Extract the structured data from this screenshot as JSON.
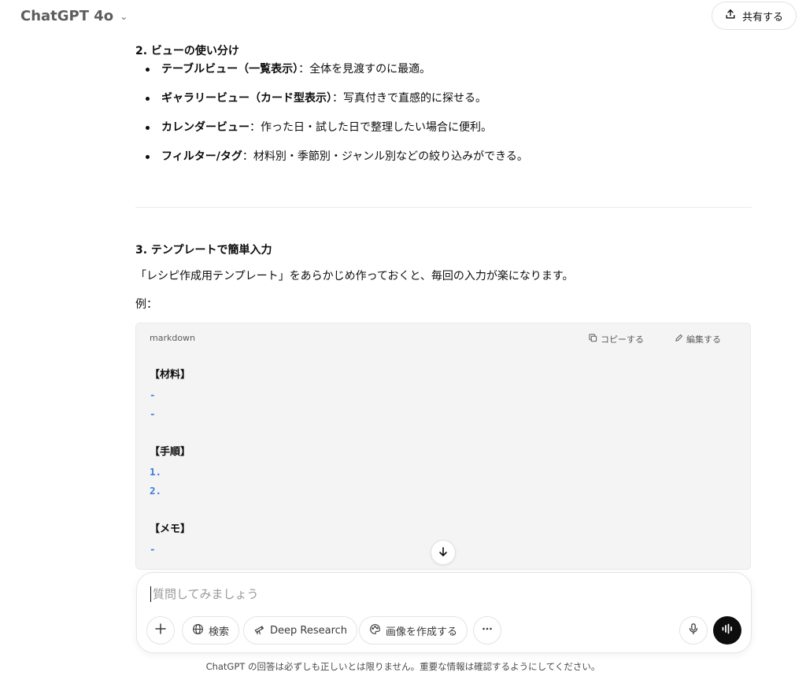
{
  "header": {
    "model": "ChatGPT 4o",
    "share_label": "共有する"
  },
  "section2": {
    "heading": "2. ビューの使い分け",
    "items": [
      {
        "bold": "テーブルビュー（一覧表示）",
        "text": "：全体を見渡すのに最適。"
      },
      {
        "bold": "ギャラリービュー（カード型表示）",
        "text": "：写真付きで直感的に探せる。"
      },
      {
        "bold": "カレンダービュー",
        "text": "：作った日・試した日で整理したい場合に便利。"
      },
      {
        "bold": "フィルター/タグ",
        "text": "：材料別・季節別・ジャンル別などの絞り込みができる。"
      }
    ]
  },
  "section3": {
    "heading": "3. テンプレートで簡単入力",
    "description": "「レシピ作成用テンプレート」をあらかじめ作っておくと、毎回の入力が楽になります。",
    "example_label": "例："
  },
  "code": {
    "language": "markdown",
    "copy_label": "コピーする",
    "edit_label": "編集する",
    "lines": [
      {
        "type": "heading",
        "text": "【材料】"
      },
      {
        "type": "marker",
        "text": "-"
      },
      {
        "type": "marker",
        "text": "-"
      },
      {
        "type": "blank",
        "text": ""
      },
      {
        "type": "heading",
        "text": "【手順】"
      },
      {
        "type": "marker",
        "text": "1."
      },
      {
        "type": "marker",
        "text": "2."
      },
      {
        "type": "blank",
        "text": ""
      },
      {
        "type": "heading",
        "text": "【メモ】"
      },
      {
        "type": "marker",
        "text": "-"
      }
    ]
  },
  "composer": {
    "placeholder": "質問してみましょう",
    "search_label": "検索",
    "deep_research_label": "Deep Research",
    "image_label": "画像を作成する"
  },
  "footer": {
    "disclaimer": "ChatGPT の回答は必ずしも正しいとは限りません。重要な情報は確認するようにしてください。"
  },
  "icons": {
    "share": "upload-icon",
    "copy": "copy-icon",
    "edit": "pencil-icon",
    "scroll": "arrow-down-icon",
    "add": "plus-icon",
    "search": "globe-icon",
    "research": "telescope-icon",
    "image": "palette-icon",
    "more": "ellipsis-icon",
    "mic": "mic-icon",
    "voice": "waveform-icon"
  },
  "colors": {
    "code_marker": "#3c7dd9",
    "code_bg": "#f4f4f5",
    "voice_button": "#0d0d0d"
  }
}
